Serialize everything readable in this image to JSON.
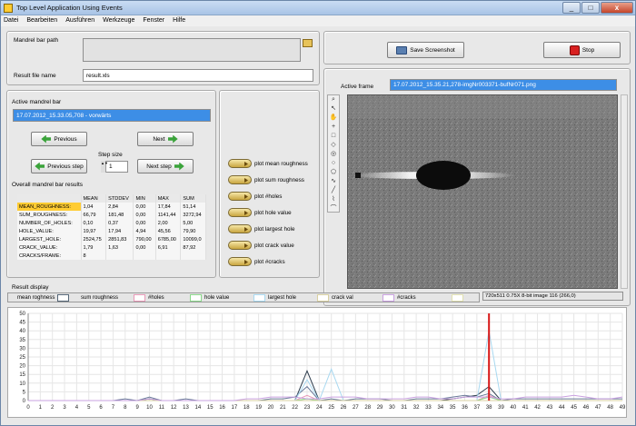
{
  "window": {
    "title": "Top Level Application Using Events",
    "controls": [
      "_",
      "□",
      "x"
    ]
  },
  "menu": [
    "Datei",
    "Bearbeiten",
    "Ausführen",
    "Werkzeuge",
    "Fenster",
    "Hilfe"
  ],
  "paths": {
    "mandrel_label": "Mandrel bar path",
    "mandrel_value": "",
    "result_label": "Result file name",
    "result_value": "result.xls"
  },
  "active": {
    "label": "Active mandrel bar",
    "value": "17.07.2012_15.33.05,708 - vorwärts",
    "previous": "Previous",
    "next": "Next",
    "previous_step": "Previous step",
    "next_step": "Next step",
    "step_label": "Step size",
    "step_value": "1"
  },
  "results": {
    "label": "Overall mandrel bar results",
    "headers": [
      "",
      "MEAN",
      "STDDEV",
      "MIN",
      "MAX",
      "SUM"
    ],
    "rows": [
      [
        "MEAN_ROUGHNESS:",
        "1,04",
        "2,84",
        "0,00",
        "17,84",
        "51,14"
      ],
      [
        "SUM_ROUGHNESS:",
        "66,79",
        "181,48",
        "0,00",
        "1141,44",
        "3272,94"
      ],
      [
        "NUMBER_OF_HOLES:",
        "0,10",
        "0,37",
        "0,00",
        "2,00",
        "5,00"
      ],
      [
        "HOLE_VALUE:",
        "19,97",
        "17,94",
        "4,94",
        "45,56",
        "79,90"
      ],
      [
        "LARGEST_HOLE:",
        "2524,75",
        "2851,83",
        "790,00",
        "6785,00",
        "10099,0"
      ],
      [
        "CRACK_VALUE:",
        "1,79",
        "1,63",
        "0,00",
        "6,91",
        "87,92"
      ],
      [
        "CRACKS/FRAME:",
        "8",
        "",
        "",
        "",
        ""
      ]
    ]
  },
  "plot_buttons": [
    "plot mean roughness",
    "plot sum roughness",
    "plot #holes",
    "plot hole value",
    "plot largest hole",
    "plot crack value",
    "plot #cracks"
  ],
  "actions": {
    "save": "Save Screenshot",
    "stop": "Stop"
  },
  "frame": {
    "label": "Active frame",
    "value": "17.07.2012_15.35.21,278-imgNr003371-bufNr071.png",
    "status": "720x511 0.75X 8-bit image 116     (266,0)"
  },
  "icons": {
    "folder": "folder-icon",
    "save": "camera-icon",
    "stop": "stop-icon",
    "tools": [
      "zoom-icon",
      "pointer-icon",
      "pan-icon",
      "crosshair-icon",
      "rect-icon",
      "rotated-rect-icon",
      "annulus-icon",
      "ellipse-icon",
      "polygon-icon",
      "freehand-icon",
      "line-icon",
      "broken-line-icon",
      "curve-icon"
    ]
  },
  "graph": {
    "label": "Result display",
    "legend": [
      {
        "name": "mean roghness",
        "color": "#556677"
      },
      {
        "name": "sum roughness",
        "color": "#4a6a8a"
      },
      {
        "name": "#holes",
        "color": "#e899b8"
      },
      {
        "name": "hole value",
        "color": "#8ad88a"
      },
      {
        "name": "largest hole",
        "color": "#a8d8f0"
      },
      {
        "name": "crack val",
        "color": "#e0e0b0"
      },
      {
        "name": "#cracks",
        "color": "#c9a0e0"
      }
    ],
    "ylim": [
      0,
      50
    ],
    "yticks": [
      0,
      5,
      10,
      15,
      20,
      25,
      30,
      35,
      40,
      45,
      50
    ],
    "xticks": [
      "0",
      "1",
      "2",
      "3",
      "4",
      "5",
      "6",
      "7",
      "8",
      "9",
      "10",
      "11",
      "12",
      "13",
      "14",
      "15",
      "16",
      "17",
      "18",
      "19",
      "20",
      "21",
      "22",
      "23",
      "24",
      "25",
      "26",
      "27",
      "28",
      "29",
      "30",
      "31",
      "32",
      "33",
      "34",
      "35",
      "36",
      "37",
      "38",
      "39",
      "40",
      "41",
      "42",
      "43",
      "44",
      "45",
      "46",
      "47",
      "48",
      "49"
    ],
    "cursor_x": 38,
    "cursor_color": "#d81818"
  },
  "chart_data": {
    "type": "line",
    "x": [
      0,
      1,
      2,
      3,
      4,
      5,
      6,
      7,
      8,
      9,
      10,
      11,
      12,
      13,
      14,
      15,
      16,
      17,
      18,
      19,
      20,
      21,
      22,
      23,
      24,
      25,
      26,
      27,
      28,
      29,
      30,
      31,
      32,
      33,
      34,
      35,
      36,
      37,
      38,
      39,
      40,
      41,
      42,
      43,
      44,
      45,
      46,
      47,
      48,
      49
    ],
    "xlabel": "",
    "ylabel": "",
    "ylim": [
      0,
      50
    ],
    "series": [
      {
        "name": "mean roghness",
        "color": "#2d3d4d",
        "values": [
          0,
          0,
          0,
          0,
          0,
          0,
          0,
          0,
          0,
          0,
          1,
          0,
          0,
          0,
          0,
          0,
          0,
          0,
          0,
          0,
          0,
          0,
          0,
          17,
          0,
          0,
          0,
          0,
          0,
          0,
          0,
          0,
          0,
          0,
          0,
          1,
          2,
          3,
          8,
          0,
          0,
          0,
          0,
          0,
          0,
          0,
          0,
          0,
          0,
          0
        ]
      },
      {
        "name": "sum roughness",
        "color": "#6a7a99",
        "values": [
          0,
          0,
          0,
          0,
          0,
          0,
          0,
          0,
          1,
          0,
          2,
          0,
          0,
          1,
          0,
          0,
          0,
          0,
          0,
          0,
          1,
          1,
          2,
          8,
          0,
          1,
          0,
          1,
          1,
          1,
          0,
          0,
          1,
          1,
          1,
          2,
          3,
          2,
          4,
          0,
          1,
          1,
          1,
          1,
          1,
          1,
          1,
          1,
          1,
          1
        ]
      },
      {
        "name": "#holes",
        "color": "#e899b8",
        "values": [
          0,
          0,
          0,
          0,
          0,
          0,
          0,
          0,
          0,
          0,
          0,
          0,
          0,
          0,
          0,
          0,
          0,
          0,
          0,
          0,
          0,
          0,
          0,
          3,
          0,
          0,
          0,
          0,
          0,
          0,
          0,
          0,
          0,
          0,
          0,
          0,
          0,
          0,
          3,
          0,
          0,
          0,
          0,
          0,
          0,
          0,
          0,
          0,
          0,
          0
        ]
      },
      {
        "name": "hole value",
        "color": "#8ad88a",
        "values": [
          0,
          0,
          0,
          0,
          0,
          0,
          0,
          0,
          0,
          0,
          0,
          0,
          0,
          0,
          0,
          0,
          0,
          0,
          0,
          0,
          0,
          0,
          0,
          1,
          0,
          0,
          0,
          0,
          0,
          0,
          0,
          0,
          0,
          0,
          0,
          0,
          0,
          0,
          2,
          0,
          0,
          0,
          0,
          0,
          0,
          0,
          0,
          0,
          0,
          0
        ]
      },
      {
        "name": "largest hole",
        "color": "#a8d8f0",
        "values": [
          0,
          0,
          0,
          0,
          0,
          0,
          0,
          0,
          0,
          0,
          0,
          0,
          0,
          0,
          0,
          0,
          0,
          0,
          0,
          0,
          0,
          0,
          0,
          12,
          0,
          18,
          0,
          0,
          0,
          0,
          0,
          0,
          0,
          0,
          0,
          0,
          0,
          0,
          40,
          0,
          0,
          0,
          0,
          0,
          0,
          0,
          0,
          0,
          0,
          0
        ]
      },
      {
        "name": "crack val",
        "color": "#d8d0a0",
        "values": [
          0,
          0,
          0,
          0,
          0,
          0,
          0,
          0,
          0,
          0,
          0,
          0,
          0,
          0,
          0,
          0,
          0,
          0,
          0,
          0,
          0,
          0,
          0,
          0,
          0,
          0,
          0,
          0,
          0,
          0,
          0,
          0,
          0,
          0,
          0,
          0,
          0,
          0,
          0,
          0,
          0,
          0,
          0,
          0,
          0,
          0,
          0,
          0,
          0,
          0
        ]
      },
      {
        "name": "#cracks",
        "color": "#c9a0e0",
        "values": [
          0,
          0,
          0,
          0,
          0,
          0,
          0,
          0,
          0,
          0,
          1,
          0,
          0,
          0,
          0,
          0,
          0,
          0,
          1,
          1,
          2,
          2,
          2,
          1,
          1,
          2,
          2,
          2,
          1,
          1,
          1,
          1,
          2,
          2,
          1,
          1,
          2,
          2,
          2,
          1,
          1,
          2,
          2,
          2,
          2,
          3,
          2,
          1,
          1,
          2
        ]
      }
    ]
  }
}
